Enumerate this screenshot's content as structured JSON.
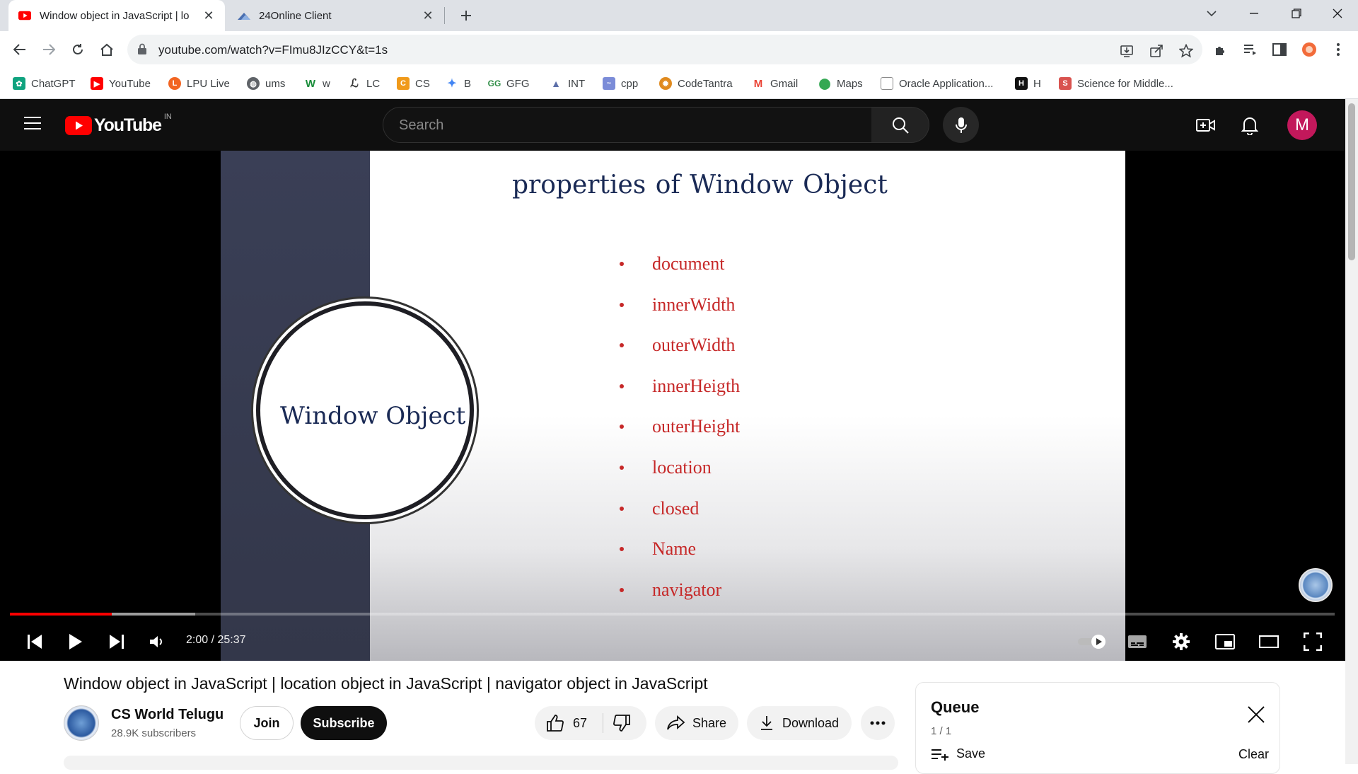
{
  "browser": {
    "tabs": [
      {
        "title": "Window object in JavaScript | lo",
        "active": true,
        "icon": "youtube-icon"
      },
      {
        "title": "24Online Client",
        "active": false,
        "icon": "24online-icon"
      }
    ],
    "url": "youtube.com/watch?v=FImu8JIzCCY&t=1s",
    "bookmarks": [
      {
        "label": "ChatGPT",
        "color": "#10a37f",
        "icon": "chatgpt-icon"
      },
      {
        "label": "YouTube",
        "color": "#ff0000",
        "icon": "youtube-icon"
      },
      {
        "label": "LPU Live",
        "color": "#f26522",
        "icon": "lpu-icon"
      },
      {
        "label": "ums",
        "color": "#5f6368",
        "icon": "globe-icon"
      },
      {
        "label": "w",
        "color": "#1a8d3b",
        "icon": "w-icon"
      },
      {
        "label": "LC",
        "color": "#333333",
        "icon": "leetcode-icon"
      },
      {
        "label": "CS",
        "color": "#f09a1a",
        "icon": "codechef-icon"
      },
      {
        "label": "B",
        "color": "#4285f4",
        "icon": "bard-icon"
      },
      {
        "label": "GFG",
        "color": "#2f8d46",
        "icon": "gfg-icon"
      },
      {
        "label": "INT",
        "color": "#5b6ea8",
        "icon": "int-icon"
      },
      {
        "label": "cpp",
        "color": "#7b8cd8",
        "icon": "cpp-icon"
      },
      {
        "label": "CodeTantra",
        "color": "#e08a1e",
        "icon": "codetantra-icon"
      },
      {
        "label": "Gmail",
        "color": "#ea4335",
        "icon": "gmail-icon"
      },
      {
        "label": "Maps",
        "color": "#34a853",
        "icon": "maps-icon"
      },
      {
        "label": "Oracle Application...",
        "color": "#8a8a8a",
        "icon": "oracle-icon"
      },
      {
        "label": "H",
        "color": "#111111",
        "icon": "hackerrank-icon"
      },
      {
        "label": "Science for Middle...",
        "color": "#d9534f",
        "icon": "science-icon"
      }
    ]
  },
  "youtube": {
    "logo_text": "YouTube",
    "region": "IN",
    "search_placeholder": "Search",
    "avatar_letter": "M",
    "accent": "#ff0000"
  },
  "video": {
    "slide_title": "properties  of Window Object",
    "circle_label": "Window Object",
    "bullets": [
      "document",
      "innerWidth",
      "outerWidth",
      "innerHeigth",
      "outerHeight",
      "location",
      "closed",
      "Name",
      "navigator"
    ],
    "time": "2:00 / 25:37",
    "progress_played": 0.077,
    "progress_buffered": 0.14,
    "autoplay": true
  },
  "meta": {
    "title": "Window object in JavaScript | location object in JavaScript | navigator object in JavaScript",
    "channel": "CS World Telugu",
    "subscribers": "28.9K subscribers",
    "join": "Join",
    "subscribe": "Subscribe",
    "likes": "67",
    "share": "Share",
    "download": "Download"
  },
  "queue": {
    "title": "Queue",
    "count": "1 / 1",
    "save": "Save",
    "clear": "Clear"
  }
}
